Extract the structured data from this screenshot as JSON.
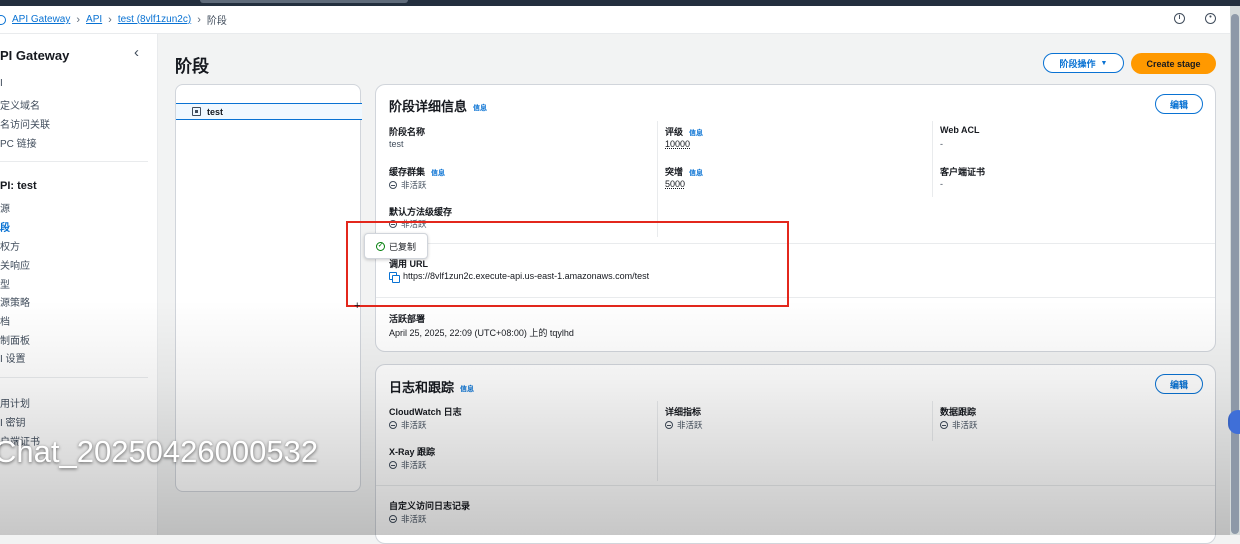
{
  "breadcrumb": [
    "API Gateway",
    "API",
    "test (8vlf1zun2c)",
    "阶段"
  ],
  "sidebar": {
    "title": "PI Gateway",
    "top_items": [
      "I",
      "定义域名",
      "名访问关联",
      "PC 链接"
    ],
    "api_header": "PI: test",
    "api_items": [
      "源",
      "段",
      "权方",
      "关响应",
      "型",
      "源策略",
      "档",
      "制面板",
      "I 设置"
    ],
    "bottom_items": [
      "用计划",
      "I 密钥",
      "户端证书"
    ]
  },
  "page": {
    "title": "阶段",
    "stage_actions_label": "阶段操作",
    "create_stage_label": "Create stage"
  },
  "tree": {
    "item": "test"
  },
  "stage_details": {
    "title": "阶段详细信息",
    "info": "信息",
    "edit": "编辑",
    "stage_name_label": "阶段名称",
    "stage_name": "test",
    "rate_label": "评级",
    "rate": "10000",
    "web_acl_label": "Web ACL",
    "web_acl": "-",
    "cache_label": "缓存群集",
    "cache_status": "非活跃",
    "burst_label": "突增",
    "burst": "5000",
    "client_cert_label": "客户端证书",
    "client_cert": "-",
    "method_cache_label": "默认方法级缓存",
    "method_cache_status": "非活跃",
    "invoke_url_label": "调用 URL",
    "invoke_url": "https://8vlf1zun2c.execute-api.us-east-1.amazonaws.com/test",
    "active_deploy_label": "活跃部署",
    "active_deploy": "April 25, 2025, 22:09 (UTC+08:00) 上的 tqylhd"
  },
  "toast": {
    "text": "已复制"
  },
  "logs": {
    "title": "日志和跟踪",
    "info": "信息",
    "edit": "编辑",
    "cloudwatch_label": "CloudWatch 日志",
    "cloudwatch_status": "非活跃",
    "metrics_label": "详细指标",
    "metrics_status": "非活跃",
    "data_trace_label": "数据跟踪",
    "data_trace_status": "非活跃",
    "xray_label": "X-Ray 跟踪",
    "xray_status": "非活跃",
    "custom_log_label": "自定义访问日志记录",
    "custom_log_status": "非活跃"
  },
  "watermark": "Chat_20250426000532",
  "colors": {
    "accent": "#0972d3",
    "primary_button": "#ff9900",
    "highlight": "#e3271c",
    "success": "#037f0c"
  }
}
